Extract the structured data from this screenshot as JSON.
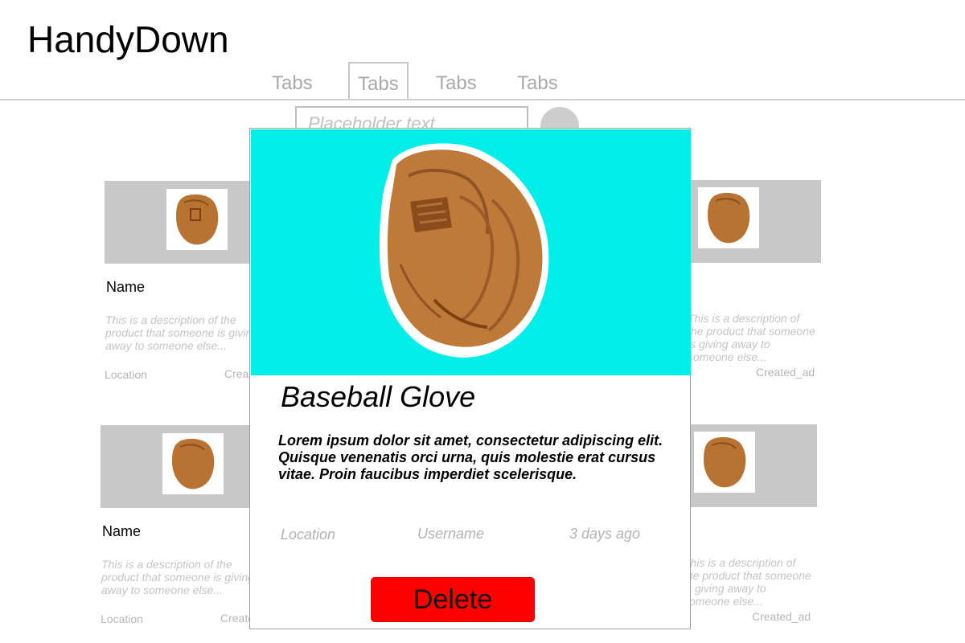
{
  "app": {
    "title": "HandyDown"
  },
  "tabs": [
    {
      "label": "Tabs",
      "active": false
    },
    {
      "label": "Tabs",
      "active": true
    },
    {
      "label": "Tabs",
      "active": false
    },
    {
      "label": "Tabs",
      "active": false
    }
  ],
  "search": {
    "placeholder": "Placeholder text"
  },
  "cards": [
    {
      "name": "Name",
      "description": "This is a description of the product that someone is giving away to someone else...",
      "location": "Location",
      "created": "Created_ad",
      "image_icon": "baseball-glove-icon"
    },
    {
      "name": "",
      "description": "This is a description of the product that someone is giving away to someone else...",
      "location": "",
      "created": "Created_ad",
      "image_icon": "baseball-glove-icon"
    },
    {
      "name": "Name",
      "description": "This is a description of the product that someone is giving away to someone else...",
      "location": "Location",
      "created": "Created_ad",
      "image_icon": "baseball-glove-icon"
    },
    {
      "name": "",
      "description": "This is a description of the product that someone is giving away to someone else...",
      "location": "",
      "created": "Created_ad",
      "image_icon": "baseball-glove-icon"
    }
  ],
  "modal": {
    "title": "Baseball Glove",
    "description": "Lorem ipsum dolor sit amet, consectetur adipiscing elit. Quisque venenatis orci urna, quis molestie erat cursus vitae. Proin faucibus imperdiet scelerisque.",
    "location": "Location",
    "username": "Username",
    "time_ago": "3 days ago",
    "delete_label": "Delete",
    "image_icon": "baseball-glove-icon",
    "image_bg": "#00eee8",
    "delete_color": "#ff0000"
  }
}
